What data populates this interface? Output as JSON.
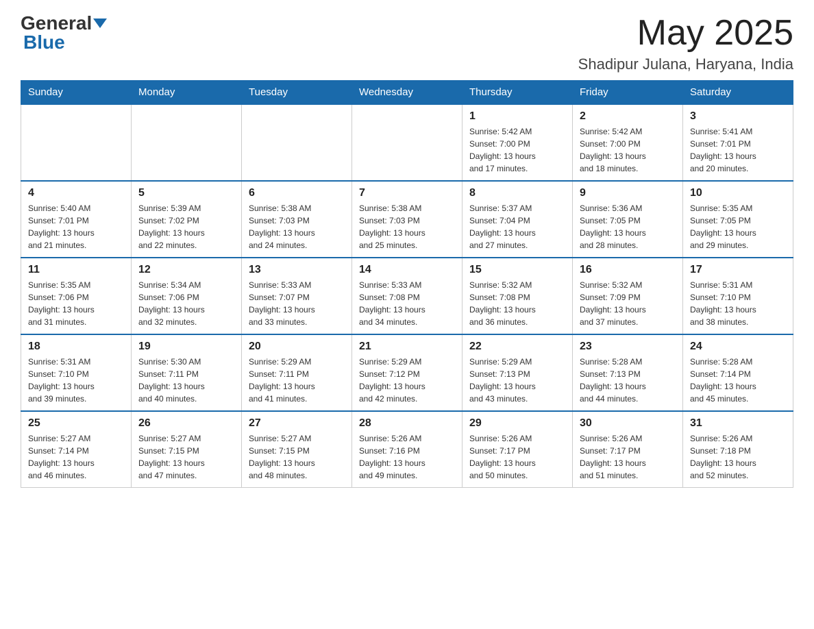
{
  "header": {
    "logo_general": "General",
    "logo_blue": "Blue",
    "month_title": "May 2025",
    "location": "Shadipur Julana, Haryana, India"
  },
  "calendar": {
    "days_of_week": [
      "Sunday",
      "Monday",
      "Tuesday",
      "Wednesday",
      "Thursday",
      "Friday",
      "Saturday"
    ],
    "weeks": [
      [
        {
          "day": "",
          "info": ""
        },
        {
          "day": "",
          "info": ""
        },
        {
          "day": "",
          "info": ""
        },
        {
          "day": "",
          "info": ""
        },
        {
          "day": "1",
          "info": "Sunrise: 5:42 AM\nSunset: 7:00 PM\nDaylight: 13 hours\nand 17 minutes."
        },
        {
          "day": "2",
          "info": "Sunrise: 5:42 AM\nSunset: 7:00 PM\nDaylight: 13 hours\nand 18 minutes."
        },
        {
          "day": "3",
          "info": "Sunrise: 5:41 AM\nSunset: 7:01 PM\nDaylight: 13 hours\nand 20 minutes."
        }
      ],
      [
        {
          "day": "4",
          "info": "Sunrise: 5:40 AM\nSunset: 7:01 PM\nDaylight: 13 hours\nand 21 minutes."
        },
        {
          "day": "5",
          "info": "Sunrise: 5:39 AM\nSunset: 7:02 PM\nDaylight: 13 hours\nand 22 minutes."
        },
        {
          "day": "6",
          "info": "Sunrise: 5:38 AM\nSunset: 7:03 PM\nDaylight: 13 hours\nand 24 minutes."
        },
        {
          "day": "7",
          "info": "Sunrise: 5:38 AM\nSunset: 7:03 PM\nDaylight: 13 hours\nand 25 minutes."
        },
        {
          "day": "8",
          "info": "Sunrise: 5:37 AM\nSunset: 7:04 PM\nDaylight: 13 hours\nand 27 minutes."
        },
        {
          "day": "9",
          "info": "Sunrise: 5:36 AM\nSunset: 7:05 PM\nDaylight: 13 hours\nand 28 minutes."
        },
        {
          "day": "10",
          "info": "Sunrise: 5:35 AM\nSunset: 7:05 PM\nDaylight: 13 hours\nand 29 minutes."
        }
      ],
      [
        {
          "day": "11",
          "info": "Sunrise: 5:35 AM\nSunset: 7:06 PM\nDaylight: 13 hours\nand 31 minutes."
        },
        {
          "day": "12",
          "info": "Sunrise: 5:34 AM\nSunset: 7:06 PM\nDaylight: 13 hours\nand 32 minutes."
        },
        {
          "day": "13",
          "info": "Sunrise: 5:33 AM\nSunset: 7:07 PM\nDaylight: 13 hours\nand 33 minutes."
        },
        {
          "day": "14",
          "info": "Sunrise: 5:33 AM\nSunset: 7:08 PM\nDaylight: 13 hours\nand 34 minutes."
        },
        {
          "day": "15",
          "info": "Sunrise: 5:32 AM\nSunset: 7:08 PM\nDaylight: 13 hours\nand 36 minutes."
        },
        {
          "day": "16",
          "info": "Sunrise: 5:32 AM\nSunset: 7:09 PM\nDaylight: 13 hours\nand 37 minutes."
        },
        {
          "day": "17",
          "info": "Sunrise: 5:31 AM\nSunset: 7:10 PM\nDaylight: 13 hours\nand 38 minutes."
        }
      ],
      [
        {
          "day": "18",
          "info": "Sunrise: 5:31 AM\nSunset: 7:10 PM\nDaylight: 13 hours\nand 39 minutes."
        },
        {
          "day": "19",
          "info": "Sunrise: 5:30 AM\nSunset: 7:11 PM\nDaylight: 13 hours\nand 40 minutes."
        },
        {
          "day": "20",
          "info": "Sunrise: 5:29 AM\nSunset: 7:11 PM\nDaylight: 13 hours\nand 41 minutes."
        },
        {
          "day": "21",
          "info": "Sunrise: 5:29 AM\nSunset: 7:12 PM\nDaylight: 13 hours\nand 42 minutes."
        },
        {
          "day": "22",
          "info": "Sunrise: 5:29 AM\nSunset: 7:13 PM\nDaylight: 13 hours\nand 43 minutes."
        },
        {
          "day": "23",
          "info": "Sunrise: 5:28 AM\nSunset: 7:13 PM\nDaylight: 13 hours\nand 44 minutes."
        },
        {
          "day": "24",
          "info": "Sunrise: 5:28 AM\nSunset: 7:14 PM\nDaylight: 13 hours\nand 45 minutes."
        }
      ],
      [
        {
          "day": "25",
          "info": "Sunrise: 5:27 AM\nSunset: 7:14 PM\nDaylight: 13 hours\nand 46 minutes."
        },
        {
          "day": "26",
          "info": "Sunrise: 5:27 AM\nSunset: 7:15 PM\nDaylight: 13 hours\nand 47 minutes."
        },
        {
          "day": "27",
          "info": "Sunrise: 5:27 AM\nSunset: 7:15 PM\nDaylight: 13 hours\nand 48 minutes."
        },
        {
          "day": "28",
          "info": "Sunrise: 5:26 AM\nSunset: 7:16 PM\nDaylight: 13 hours\nand 49 minutes."
        },
        {
          "day": "29",
          "info": "Sunrise: 5:26 AM\nSunset: 7:17 PM\nDaylight: 13 hours\nand 50 minutes."
        },
        {
          "day": "30",
          "info": "Sunrise: 5:26 AM\nSunset: 7:17 PM\nDaylight: 13 hours\nand 51 minutes."
        },
        {
          "day": "31",
          "info": "Sunrise: 5:26 AM\nSunset: 7:18 PM\nDaylight: 13 hours\nand 52 minutes."
        }
      ]
    ]
  }
}
